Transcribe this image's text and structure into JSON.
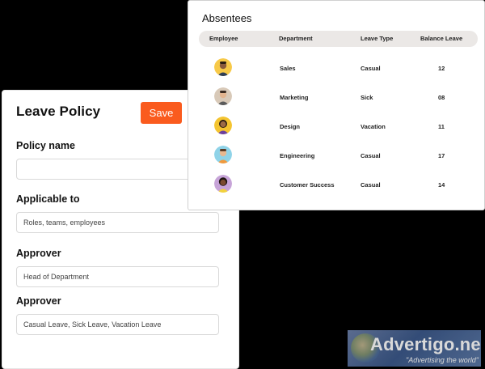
{
  "policy": {
    "title": "Leave Policy",
    "save_label": "Save",
    "fields": [
      {
        "label": "Policy name",
        "value": ""
      },
      {
        "label": "Applicable to",
        "value": "Roles, teams, employees"
      },
      {
        "label": "Approver",
        "value": "Head of Department"
      },
      {
        "label": "Approver",
        "value": "Casual Leave, Sick Leave, Vacation Leave"
      }
    ]
  },
  "absentees": {
    "title": "Absentees",
    "columns": [
      "Employee",
      "Department",
      "Leave Type",
      "Balance Leave"
    ],
    "rows": [
      {
        "department": "Sales",
        "leave_type": "Casual",
        "balance": "12",
        "avatar_bg": "#f7c948"
      },
      {
        "department": "Marketing",
        "leave_type": "Sick",
        "balance": "08",
        "avatar_bg": "#d8c9b8"
      },
      {
        "department": "Design",
        "leave_type": "Vacation",
        "balance": "11",
        "avatar_bg": "#f4c430"
      },
      {
        "department": "Engineering",
        "leave_type": "Casual",
        "balance": "17",
        "avatar_bg": "#8fd3e8"
      },
      {
        "department": "Customer Success",
        "leave_type": "Casual",
        "balance": "14",
        "avatar_bg": "#c7a4d8"
      }
    ]
  },
  "watermark": {
    "brand": "Advertigo.net",
    "tagline": "\"Advertising  the world\""
  },
  "colors": {
    "accent": "#fa5b1e",
    "background": "#000000",
    "header_row": "#ebe8e6"
  }
}
